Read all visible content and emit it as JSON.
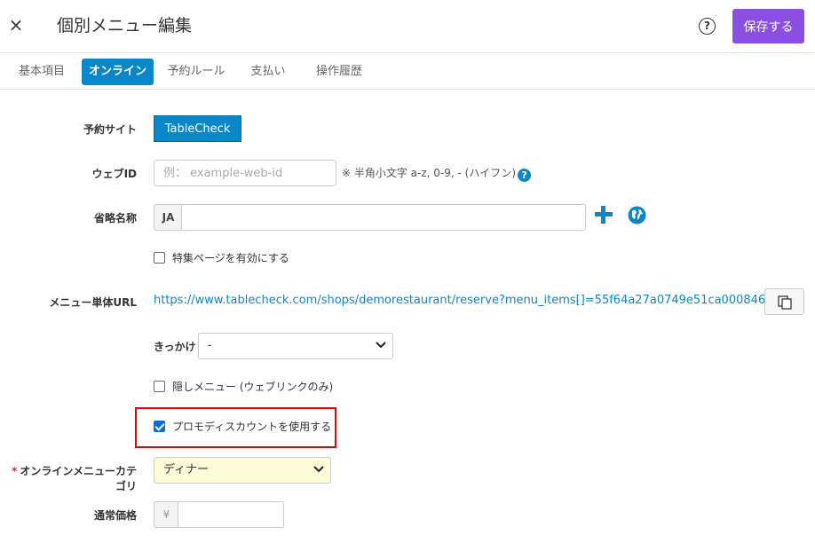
{
  "header": {
    "close_glyph": "×",
    "title": "個別メニュー編集",
    "help_glyph": "?",
    "save_label": "保存する"
  },
  "tabs": [
    {
      "label": "基本項目",
      "active": false
    },
    {
      "label": "オンライン",
      "active": true
    },
    {
      "label": "予約ルール",
      "active": false
    },
    {
      "label": "支払い",
      "active": false
    },
    {
      "label": "操作履歴",
      "active": false
    }
  ],
  "form": {
    "reserve_site": {
      "label": "予約サイト",
      "button": "TableCheck"
    },
    "web_id": {
      "label": "ウェブID",
      "placeholder": "例： example-web-id",
      "value": "",
      "note": "※ 半角小文字 a-z, 0-9, - (ハイフン)"
    },
    "short_name": {
      "label": "省略名称",
      "prefix": "JA",
      "value": ""
    },
    "feature_page": {
      "label": "特集ページを有効にする",
      "checked": false
    },
    "menu_url": {
      "label": "メニュー単体URL",
      "url": "https://www.tablecheck.com/shops/demorestaurant/reserve?menu_items[]=55f64a27a0749e51ca000846"
    },
    "trigger": {
      "label": "きっかけ",
      "value": "-"
    },
    "hidden_menu": {
      "label": "隠しメニュー (ウェブリンクのみ)",
      "checked": false
    },
    "promo_discount": {
      "label": "プロモディスカウントを使用する",
      "checked": true
    },
    "online_category": {
      "required_mark": "*",
      "label": "オンラインメニューカテゴリ",
      "value": "ディナー"
    },
    "regular_price": {
      "label": "通常価格",
      "currency": "¥",
      "value": ""
    }
  },
  "colors": {
    "accent": "#0a87c9",
    "save": "#8a4fe0",
    "highlight": "#e8000b",
    "category_bg": "#fdfbd8"
  },
  "icons": [
    "close-icon",
    "help-icon",
    "question-icon",
    "plus-icon",
    "globe-icon",
    "copy-icon",
    "chevron-down-icon"
  ]
}
